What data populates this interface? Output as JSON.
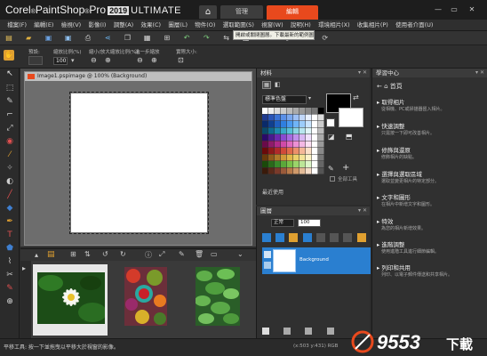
{
  "title_bar": {
    "brand_prefix": "Corel",
    "brand_name": "PaintShop",
    "brand_suffix": "Pro",
    "version": "2019",
    "edition": "ULTIMATE",
    "tabs": [
      {
        "label": "管理",
        "active": false
      },
      {
        "label": "編輯",
        "active": true
      }
    ],
    "accent_color": "#e8491d"
  },
  "menu": {
    "items": [
      "檔案(F)",
      "編輯(E)",
      "檢視(V)",
      "影像(I)",
      "調整(A)",
      "效果(C)",
      "圖層(L)",
      "物件(O)",
      "選取範圍(S)",
      "視窗(W)",
      "說明(H)",
      "環境相片(X)",
      "收集相片(P)",
      "使用者介面(U)"
    ]
  },
  "tooltip": "開啟或關閉圖層。下載最新的範例圖片",
  "tool_options": {
    "preset_label": "預設:",
    "zoom_label": "縮放比例(%)",
    "zoom_value": "100",
    "zoom_more_label": "縮小/放大縮放比例(%):",
    "step_label": "進一步縮放",
    "actual_label": "實際大小:"
  },
  "document": {
    "title": "Image1.pspimage @ 100% (Background)"
  },
  "materials": {
    "title": "材料",
    "palette_select": "標準色盤",
    "all_tools_label": "全部工具",
    "recent_label": "最近使用"
  },
  "layers": {
    "title": "圖層",
    "blend_mode": "正常",
    "opacity": "100",
    "layer_name": "Background"
  },
  "learning_center": {
    "title": "學習中心",
    "home_label": "首頁",
    "items": [
      {
        "title": "取得相片",
        "desc": "從相機、PC或掃描器匯入相片。"
      },
      {
        "title": "快速調整",
        "desc": "只需按一下即可改善相片。"
      },
      {
        "title": "修飾與還原",
        "desc": "修飾相片的缺點。"
      },
      {
        "title": "選擇與選取區域",
        "desc": "選取並變更相片的特定部分。"
      },
      {
        "title": "文字和圖形",
        "desc": "在相片中新增文字和圖形。"
      },
      {
        "title": "特效",
        "desc": "為您的相片新增效果。"
      },
      {
        "title": "進階調整",
        "desc": "使用進階工具進行細節編輯。"
      },
      {
        "title": "列印和共用",
        "desc": "列印、以電子郵件傳送和共享相片。"
      }
    ]
  },
  "status_bar": {
    "text": "平移工具: 按一下並拖曳以平移大於視窗的影像。",
    "info": "(x:503 y:431) RGB"
  },
  "watermark": {
    "number": "9553",
    "suffix": "下載"
  },
  "icons": [
    "home-icon",
    "pan-icon",
    "selection-icon",
    "crop-icon",
    "brush-icon",
    "text-icon",
    "eraser-icon",
    "zoom-icon"
  ]
}
